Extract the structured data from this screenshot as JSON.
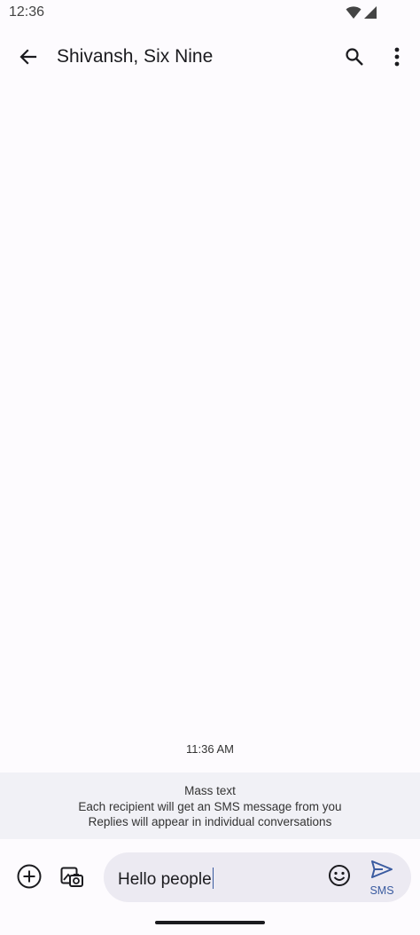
{
  "status_bar": {
    "time": "12:36"
  },
  "app_bar": {
    "title": "Shivansh, Six Nine"
  },
  "conversation": {
    "timestamp": "11:36 AM"
  },
  "mass_text_banner": {
    "heading": "Mass text",
    "line1": "Each recipient will get an SMS message from you",
    "line2": "Replies will appear in individual conversations"
  },
  "compose": {
    "message_value": "Hello people",
    "send_label": "SMS"
  },
  "colors": {
    "accent": "#3a5ba0",
    "background": "#fdfbfe",
    "banner": "#f1f1f6",
    "input": "#eceaf2"
  },
  "icons": [
    "wifi-icon",
    "signal-icon",
    "back-arrow-icon",
    "search-icon",
    "more-vert-icon",
    "add-circle-icon",
    "gallery-icon",
    "emoji-icon",
    "send-icon"
  ]
}
